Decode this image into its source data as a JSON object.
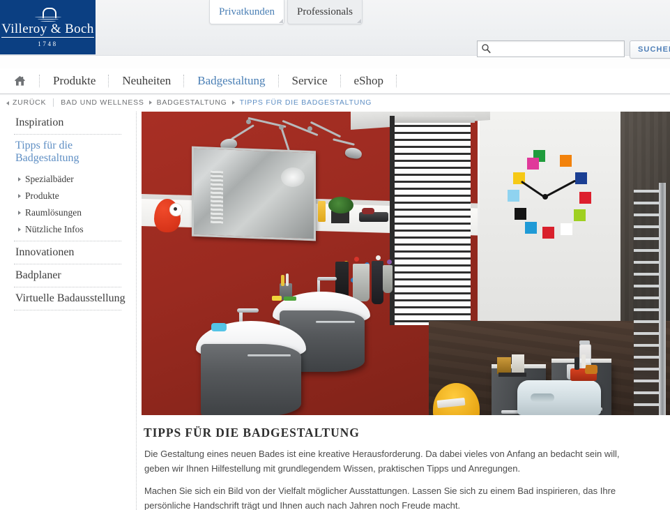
{
  "brand": {
    "name": "Villeroy & Boch",
    "year": "1748",
    "logo_icon": "fountain-arch-icon"
  },
  "audience_tabs": [
    {
      "label": "Privatkunden",
      "active": true
    },
    {
      "label": "Professionals",
      "active": false
    }
  ],
  "search": {
    "value": "",
    "placeholder": "",
    "icon": "search-icon",
    "button_label": "SUCHEN"
  },
  "mainnav": {
    "home_icon": "home-icon",
    "items": [
      {
        "label": "Produkte",
        "active": false
      },
      {
        "label": "Neuheiten",
        "active": false
      },
      {
        "label": "Badgestaltung",
        "active": true
      },
      {
        "label": "Service",
        "active": false
      },
      {
        "label": "eShop",
        "active": false
      }
    ]
  },
  "breadcrumb": {
    "back_label": "ZURÜCK",
    "items": [
      {
        "label": "BAD UND WELLNESS",
        "current": false
      },
      {
        "label": "BADGESTALTUNG",
        "current": false
      },
      {
        "label": "TIPPS FÜR DIE BADGESTALTUNG",
        "current": true
      }
    ]
  },
  "sidebar": {
    "items": [
      {
        "label": "Inspiration",
        "active": false
      },
      {
        "label": "Tipps für die Badgestaltung",
        "active": true
      },
      {
        "label": "Innovationen",
        "active": false
      },
      {
        "label": "Badplaner",
        "active": false
      },
      {
        "label": "Virtuelle Badausstellung",
        "active": false
      }
    ],
    "sub_items": [
      {
        "label": "Spezialbäder"
      },
      {
        "label": "Produkte"
      },
      {
        "label": "Raumlösungen"
      },
      {
        "label": "Nützliche Infos"
      }
    ]
  },
  "main": {
    "hero_alt": "Modernes Badezimmer mit roter Wand, Doppelwaschtisch und bunter Design-Wanduhr",
    "title": "TIPPS FÜR DIE BADGESTALTUNG",
    "paragraph_1": "Die Gestaltung eines neuen Bades ist eine kreative Herausforderung. Da dabei vieles von Anfang an bedacht sein will, geben wir Ihnen Hilfestellung mit grundlegendem Wissen, praktischen Tipps und Anregungen.",
    "paragraph_2": "Machen Sie sich ein Bild von der Vielfalt möglicher Ausstattungen. Lassen Sie sich zu einem Bad inspirieren, das Ihre persönliche Handschrift trägt und Ihnen auch nach Jahren noch Freude macht."
  },
  "colors": {
    "brand_blue": "#0b3f82",
    "link_blue": "#5f8fc4",
    "wall_red": "#9a2a20",
    "cabinet_grey": "#45484b",
    "chair_yellow": "#ffcb3d"
  },
  "clock_squares": [
    {
      "color": "#1f9c3c",
      "pos": "12"
    },
    {
      "color": "#f2820c",
      "pos": "1"
    },
    {
      "color": "#1b3f93",
      "pos": "2"
    },
    {
      "color": "#dd1f2d",
      "pos": "3"
    },
    {
      "color": "#9fd021",
      "pos": "4"
    },
    {
      "color": "#ffffff",
      "pos": "5"
    },
    {
      "color": "#d9202c",
      "pos": "6"
    },
    {
      "color": "#1f9ad6",
      "pos": "7"
    },
    {
      "color": "#141414",
      "pos": "8"
    },
    {
      "color": "#8fd3f0",
      "pos": "9"
    },
    {
      "color": "#f6c915",
      "pos": "10"
    },
    {
      "color": "#e0399a",
      "pos": "11"
    }
  ]
}
